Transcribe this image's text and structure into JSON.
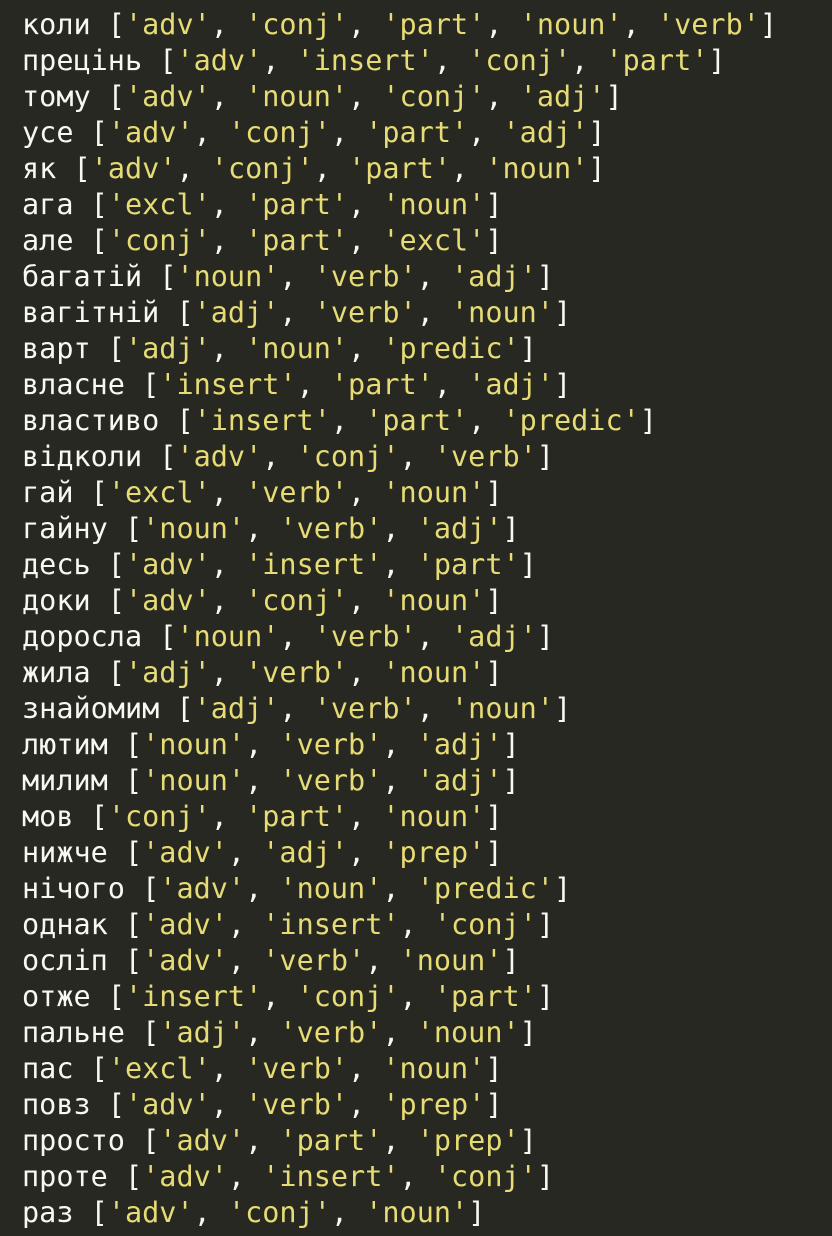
{
  "colors": {
    "background": "#272822",
    "text": "#f8f8f2",
    "string": "#e6db74"
  },
  "lines": [
    {
      "word": "коли",
      "tags": [
        "adv",
        "conj",
        "part",
        "noun",
        "verb"
      ]
    },
    {
      "word": "прецінь",
      "tags": [
        "adv",
        "insert",
        "conj",
        "part"
      ]
    },
    {
      "word": "тому",
      "tags": [
        "adv",
        "noun",
        "conj",
        "adj"
      ]
    },
    {
      "word": "усе",
      "tags": [
        "adv",
        "conj",
        "part",
        "adj"
      ]
    },
    {
      "word": "як",
      "tags": [
        "adv",
        "conj",
        "part",
        "noun"
      ]
    },
    {
      "word": "ага",
      "tags": [
        "excl",
        "part",
        "noun"
      ]
    },
    {
      "word": "але",
      "tags": [
        "conj",
        "part",
        "excl"
      ]
    },
    {
      "word": "багатій",
      "tags": [
        "noun",
        "verb",
        "adj"
      ]
    },
    {
      "word": "вагітній",
      "tags": [
        "adj",
        "verb",
        "noun"
      ]
    },
    {
      "word": "варт",
      "tags": [
        "adj",
        "noun",
        "predic"
      ]
    },
    {
      "word": "власне",
      "tags": [
        "insert",
        "part",
        "adj"
      ]
    },
    {
      "word": "властиво",
      "tags": [
        "insert",
        "part",
        "predic"
      ]
    },
    {
      "word": "відколи",
      "tags": [
        "adv",
        "conj",
        "verb"
      ]
    },
    {
      "word": "гай",
      "tags": [
        "excl",
        "verb",
        "noun"
      ]
    },
    {
      "word": "гайну",
      "tags": [
        "noun",
        "verb",
        "adj"
      ]
    },
    {
      "word": "десь",
      "tags": [
        "adv",
        "insert",
        "part"
      ]
    },
    {
      "word": "доки",
      "tags": [
        "adv",
        "conj",
        "noun"
      ]
    },
    {
      "word": "доросла",
      "tags": [
        "noun",
        "verb",
        "adj"
      ]
    },
    {
      "word": "жила",
      "tags": [
        "adj",
        "verb",
        "noun"
      ]
    },
    {
      "word": "знайомим",
      "tags": [
        "adj",
        "verb",
        "noun"
      ]
    },
    {
      "word": "лютим",
      "tags": [
        "noun",
        "verb",
        "adj"
      ]
    },
    {
      "word": "милим",
      "tags": [
        "noun",
        "verb",
        "adj"
      ]
    },
    {
      "word": "мов",
      "tags": [
        "conj",
        "part",
        "noun"
      ]
    },
    {
      "word": "нижче",
      "tags": [
        "adv",
        "adj",
        "prep"
      ]
    },
    {
      "word": "нічого",
      "tags": [
        "adv",
        "noun",
        "predic"
      ]
    },
    {
      "word": "однак",
      "tags": [
        "adv",
        "insert",
        "conj"
      ]
    },
    {
      "word": "осліп",
      "tags": [
        "adv",
        "verb",
        "noun"
      ]
    },
    {
      "word": "отже",
      "tags": [
        "insert",
        "conj",
        "part"
      ]
    },
    {
      "word": "пальне",
      "tags": [
        "adj",
        "verb",
        "noun"
      ]
    },
    {
      "word": "пас",
      "tags": [
        "excl",
        "verb",
        "noun"
      ]
    },
    {
      "word": "повз",
      "tags": [
        "adv",
        "verb",
        "prep"
      ]
    },
    {
      "word": "просто",
      "tags": [
        "adv",
        "part",
        "prep"
      ]
    },
    {
      "word": "проте",
      "tags": [
        "adv",
        "insert",
        "conj"
      ]
    },
    {
      "word": "раз",
      "tags": [
        "adv",
        "conj",
        "noun"
      ]
    }
  ]
}
